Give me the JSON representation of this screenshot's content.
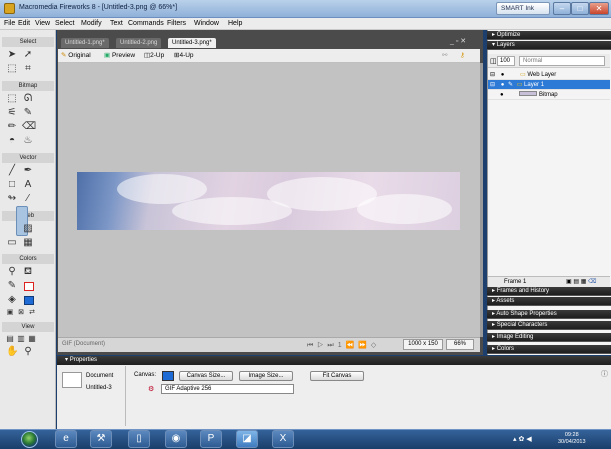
{
  "window": {
    "title": "Macromedia Fireworks 8 - [Untitled-3.png @ 66%*]",
    "smart_ink": "SMART Ink"
  },
  "menus": [
    "File",
    "Edit",
    "View",
    "Select",
    "Modify",
    "Text",
    "Commands",
    "Filters",
    "Window",
    "Help"
  ],
  "tools": {
    "sections": [
      "Select",
      "Bitmap",
      "Vector",
      "Web",
      "Colors",
      "View"
    ]
  },
  "tabs": [
    "Untitled-1.png*",
    "Untitled-2.png",
    "Untitled-3.png*"
  ],
  "view_buttons": [
    "Original",
    "Preview",
    "2-Up",
    "4-Up"
  ],
  "status": {
    "doc_type": "GIF (Document)",
    "frame": "1",
    "dimensions": "1000 x 150",
    "zoom": "66%"
  },
  "panels": {
    "optimize": "Optimize",
    "layers": "Layers",
    "opacity": "100",
    "blend_mode": "Normal",
    "layer_rows": [
      "Web Layer",
      "Layer 1",
      "Bitmap"
    ],
    "frame_label": "Frame 1",
    "collapsed": [
      "Frames and History",
      "Assets",
      "Auto Shape Properties",
      "Special Characters",
      "Image Editing",
      "Colors"
    ]
  },
  "properties": {
    "header": "Properties",
    "doc_label": "Document",
    "doc_name": "Untitled-3",
    "canvas_label": "Canvas:",
    "canvas_size_btn": "Canvas Size...",
    "image_size_btn": "Image Size...",
    "fit_canvas_btn": "Fit Canvas",
    "palette": "GIF Adaptive 256"
  },
  "taskbar": {
    "time": "09:28",
    "date": "30/04/2013"
  }
}
